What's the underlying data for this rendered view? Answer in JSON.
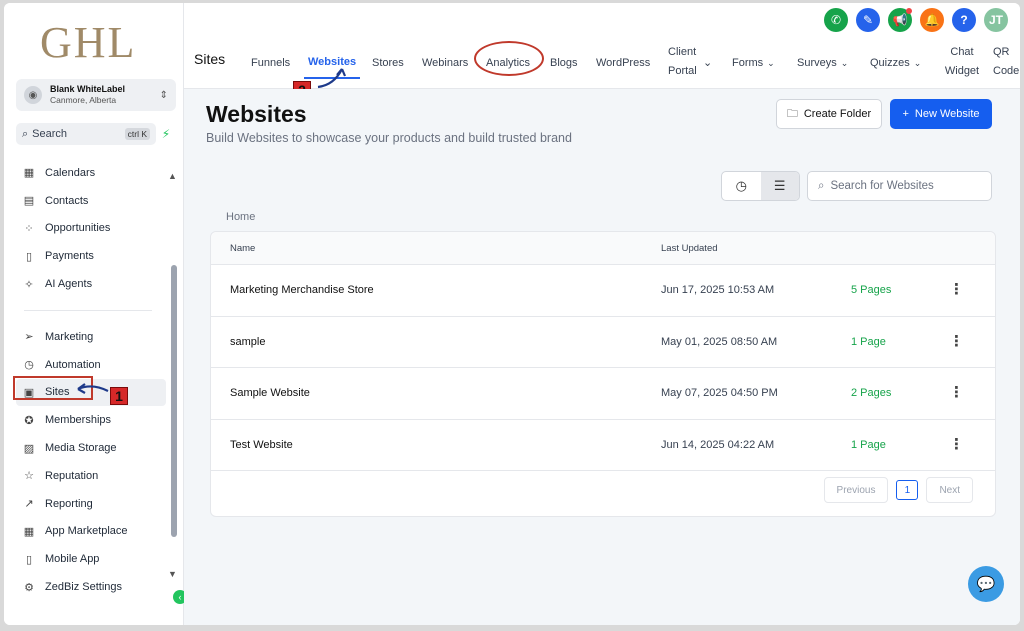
{
  "logo": "GHL",
  "account": {
    "name": "Blank WhiteLabel",
    "location": "Canmore, Alberta"
  },
  "search": {
    "label": "Search",
    "shortcut": "ctrl K"
  },
  "sidebar": {
    "items_top": [
      {
        "label": "Calendars",
        "icon": "calendar-icon",
        "glyph": "▦"
      },
      {
        "label": "Contacts",
        "icon": "contacts-icon",
        "glyph": "▤"
      },
      {
        "label": "Opportunities",
        "icon": "opportunities-icon",
        "glyph": "⁘"
      },
      {
        "label": "Payments",
        "icon": "payments-icon",
        "glyph": "▯"
      },
      {
        "label": "AI Agents",
        "icon": "sparkle-icon",
        "glyph": "✧"
      }
    ],
    "items_bottom": [
      {
        "label": "Marketing",
        "icon": "send-icon",
        "glyph": "➢"
      },
      {
        "label": "Automation",
        "icon": "automation-icon",
        "glyph": "◷"
      },
      {
        "label": "Sites",
        "icon": "sites-icon",
        "glyph": "▣"
      },
      {
        "label": "Memberships",
        "icon": "award-icon",
        "glyph": "✪"
      },
      {
        "label": "Media Storage",
        "icon": "image-icon",
        "glyph": "▨"
      },
      {
        "label": "Reputation",
        "icon": "star-icon",
        "glyph": "☆"
      },
      {
        "label": "Reporting",
        "icon": "chart-icon",
        "glyph": "↗"
      },
      {
        "label": "App Marketplace",
        "icon": "grid-icon",
        "glyph": "▦"
      },
      {
        "label": "Mobile App",
        "icon": "mobile-icon",
        "glyph": "▯"
      },
      {
        "label": "ZedBiz Settings",
        "icon": "settings-icon",
        "glyph": "⚙"
      }
    ]
  },
  "annotations": {
    "step1": "1",
    "step2": "2"
  },
  "topbar": {
    "title": "Sites",
    "tabs": [
      {
        "label": "Funnels"
      },
      {
        "label": "Websites"
      },
      {
        "label": "Stores"
      },
      {
        "label": "Webinars"
      },
      {
        "label": "Analytics"
      },
      {
        "label": "Blogs"
      },
      {
        "label": "WordPress"
      },
      {
        "label": "Client Portal"
      },
      {
        "label": "Forms"
      },
      {
        "label": "Surveys"
      },
      {
        "label": "Quizzes"
      },
      {
        "label": "Chat Widget"
      },
      {
        "label": "QR Code"
      }
    ],
    "avatar_initials": "JT",
    "help": "?"
  },
  "main": {
    "title": "Websites",
    "subtitle": "Build Websites to showcase your products and build trusted brand",
    "create_folder": "Create Folder",
    "new_website": "New Website",
    "search_placeholder": "Search for Websites",
    "breadcrumb": "Home",
    "columns": {
      "name": "Name",
      "updated": "Last Updated"
    },
    "rows": [
      {
        "name": "Marketing Merchandise Store",
        "updated": "Jun 17, 2025 10:53 AM",
        "pages": "5 Pages"
      },
      {
        "name": "sample",
        "updated": "May 01, 2025 08:50 AM",
        "pages": "1 Page"
      },
      {
        "name": "Sample Website",
        "updated": "May 07, 2025 04:50 PM",
        "pages": "2 Pages"
      },
      {
        "name": "Test Website",
        "updated": "Jun 14, 2025 04:22 AM",
        "pages": "1 Page"
      }
    ],
    "pager": {
      "previous": "Previous",
      "page": "1",
      "next": "Next"
    }
  },
  "colors": {
    "accent": "#155eef",
    "pages_green": "#16a34a",
    "annotation_red": "#c0392b"
  }
}
